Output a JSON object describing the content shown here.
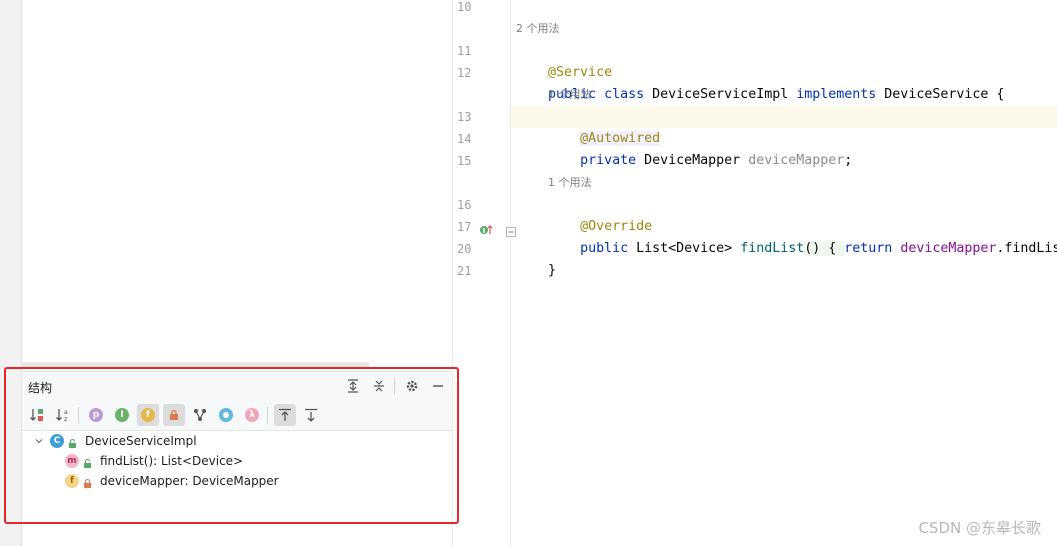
{
  "editor": {
    "lines": [
      {
        "num": "10",
        "code": []
      },
      {
        "hint": "2 个用法",
        "indent": 0
      },
      {
        "num": "11",
        "code": [
          {
            "t": "@Service",
            "c": "ann"
          }
        ]
      },
      {
        "num": "12",
        "code": [
          {
            "t": "public ",
            "c": "kw"
          },
          {
            "t": "class ",
            "c": "kw"
          },
          {
            "t": "DeviceServiceImpl ",
            "c": ""
          },
          {
            "t": "implements ",
            "c": "kw"
          },
          {
            "t": "DeviceService {",
            "c": ""
          }
        ]
      },
      {
        "hint": "1 个用法",
        "indent": 1
      },
      {
        "num": "13",
        "code": [
          {
            "t": "    ",
            "c": ""
          },
          {
            "t": "@Autowired",
            "c": "ann"
          }
        ]
      },
      {
        "num": "14",
        "code": [
          {
            "t": "    ",
            "c": ""
          },
          {
            "t": "private ",
            "c": "kw"
          },
          {
            "t": "DeviceMapper ",
            "c": ""
          },
          {
            "t": "deviceMapper",
            "c": "gray"
          },
          {
            "t": ";",
            "c": ""
          }
        ]
      },
      {
        "num": "15",
        "code": []
      },
      {
        "hint": "1 个用法",
        "indent": 1
      },
      {
        "num": "16",
        "code": [
          {
            "t": "    ",
            "c": ""
          },
          {
            "t": "@Override",
            "c": "ann"
          }
        ]
      },
      {
        "num": "17",
        "code": [
          {
            "t": "    ",
            "c": ""
          },
          {
            "t": "public ",
            "c": "kw"
          },
          {
            "t": "List<Device> ",
            "c": ""
          },
          {
            "t": "findList",
            "c": "mth"
          },
          {
            "t": "() { ",
            "c": ""
          },
          {
            "t": "return ",
            "c": "kw"
          },
          {
            "t": "deviceMapper",
            "c": "fld"
          },
          {
            "t": ".findList(); }",
            "c": ""
          }
        ]
      },
      {
        "num": "20",
        "code": [
          {
            "t": "}",
            "c": ""
          }
        ]
      },
      {
        "num": "21",
        "code": []
      }
    ]
  },
  "structure": {
    "title": "结构",
    "tree": [
      {
        "icon": "C",
        "icon_color": "#3fa0d7",
        "vis": "public",
        "label": "DeviceServiceImpl",
        "level": 0
      },
      {
        "icon": "m",
        "icon_color": "#e06b8d",
        "vis": "public",
        "label": "findList(): List<Device>",
        "level": 1
      },
      {
        "icon": "f",
        "icon_color": "#e3a637",
        "vis": "private",
        "label": "deviceMapper: DeviceMapper",
        "level": 1
      }
    ]
  },
  "watermark": "CSDN @东皋长歌",
  "colors": {
    "accent_red": "#e8262a",
    "keyword": "#0033b3",
    "annotation": "#9e880d",
    "field": "#871094"
  }
}
